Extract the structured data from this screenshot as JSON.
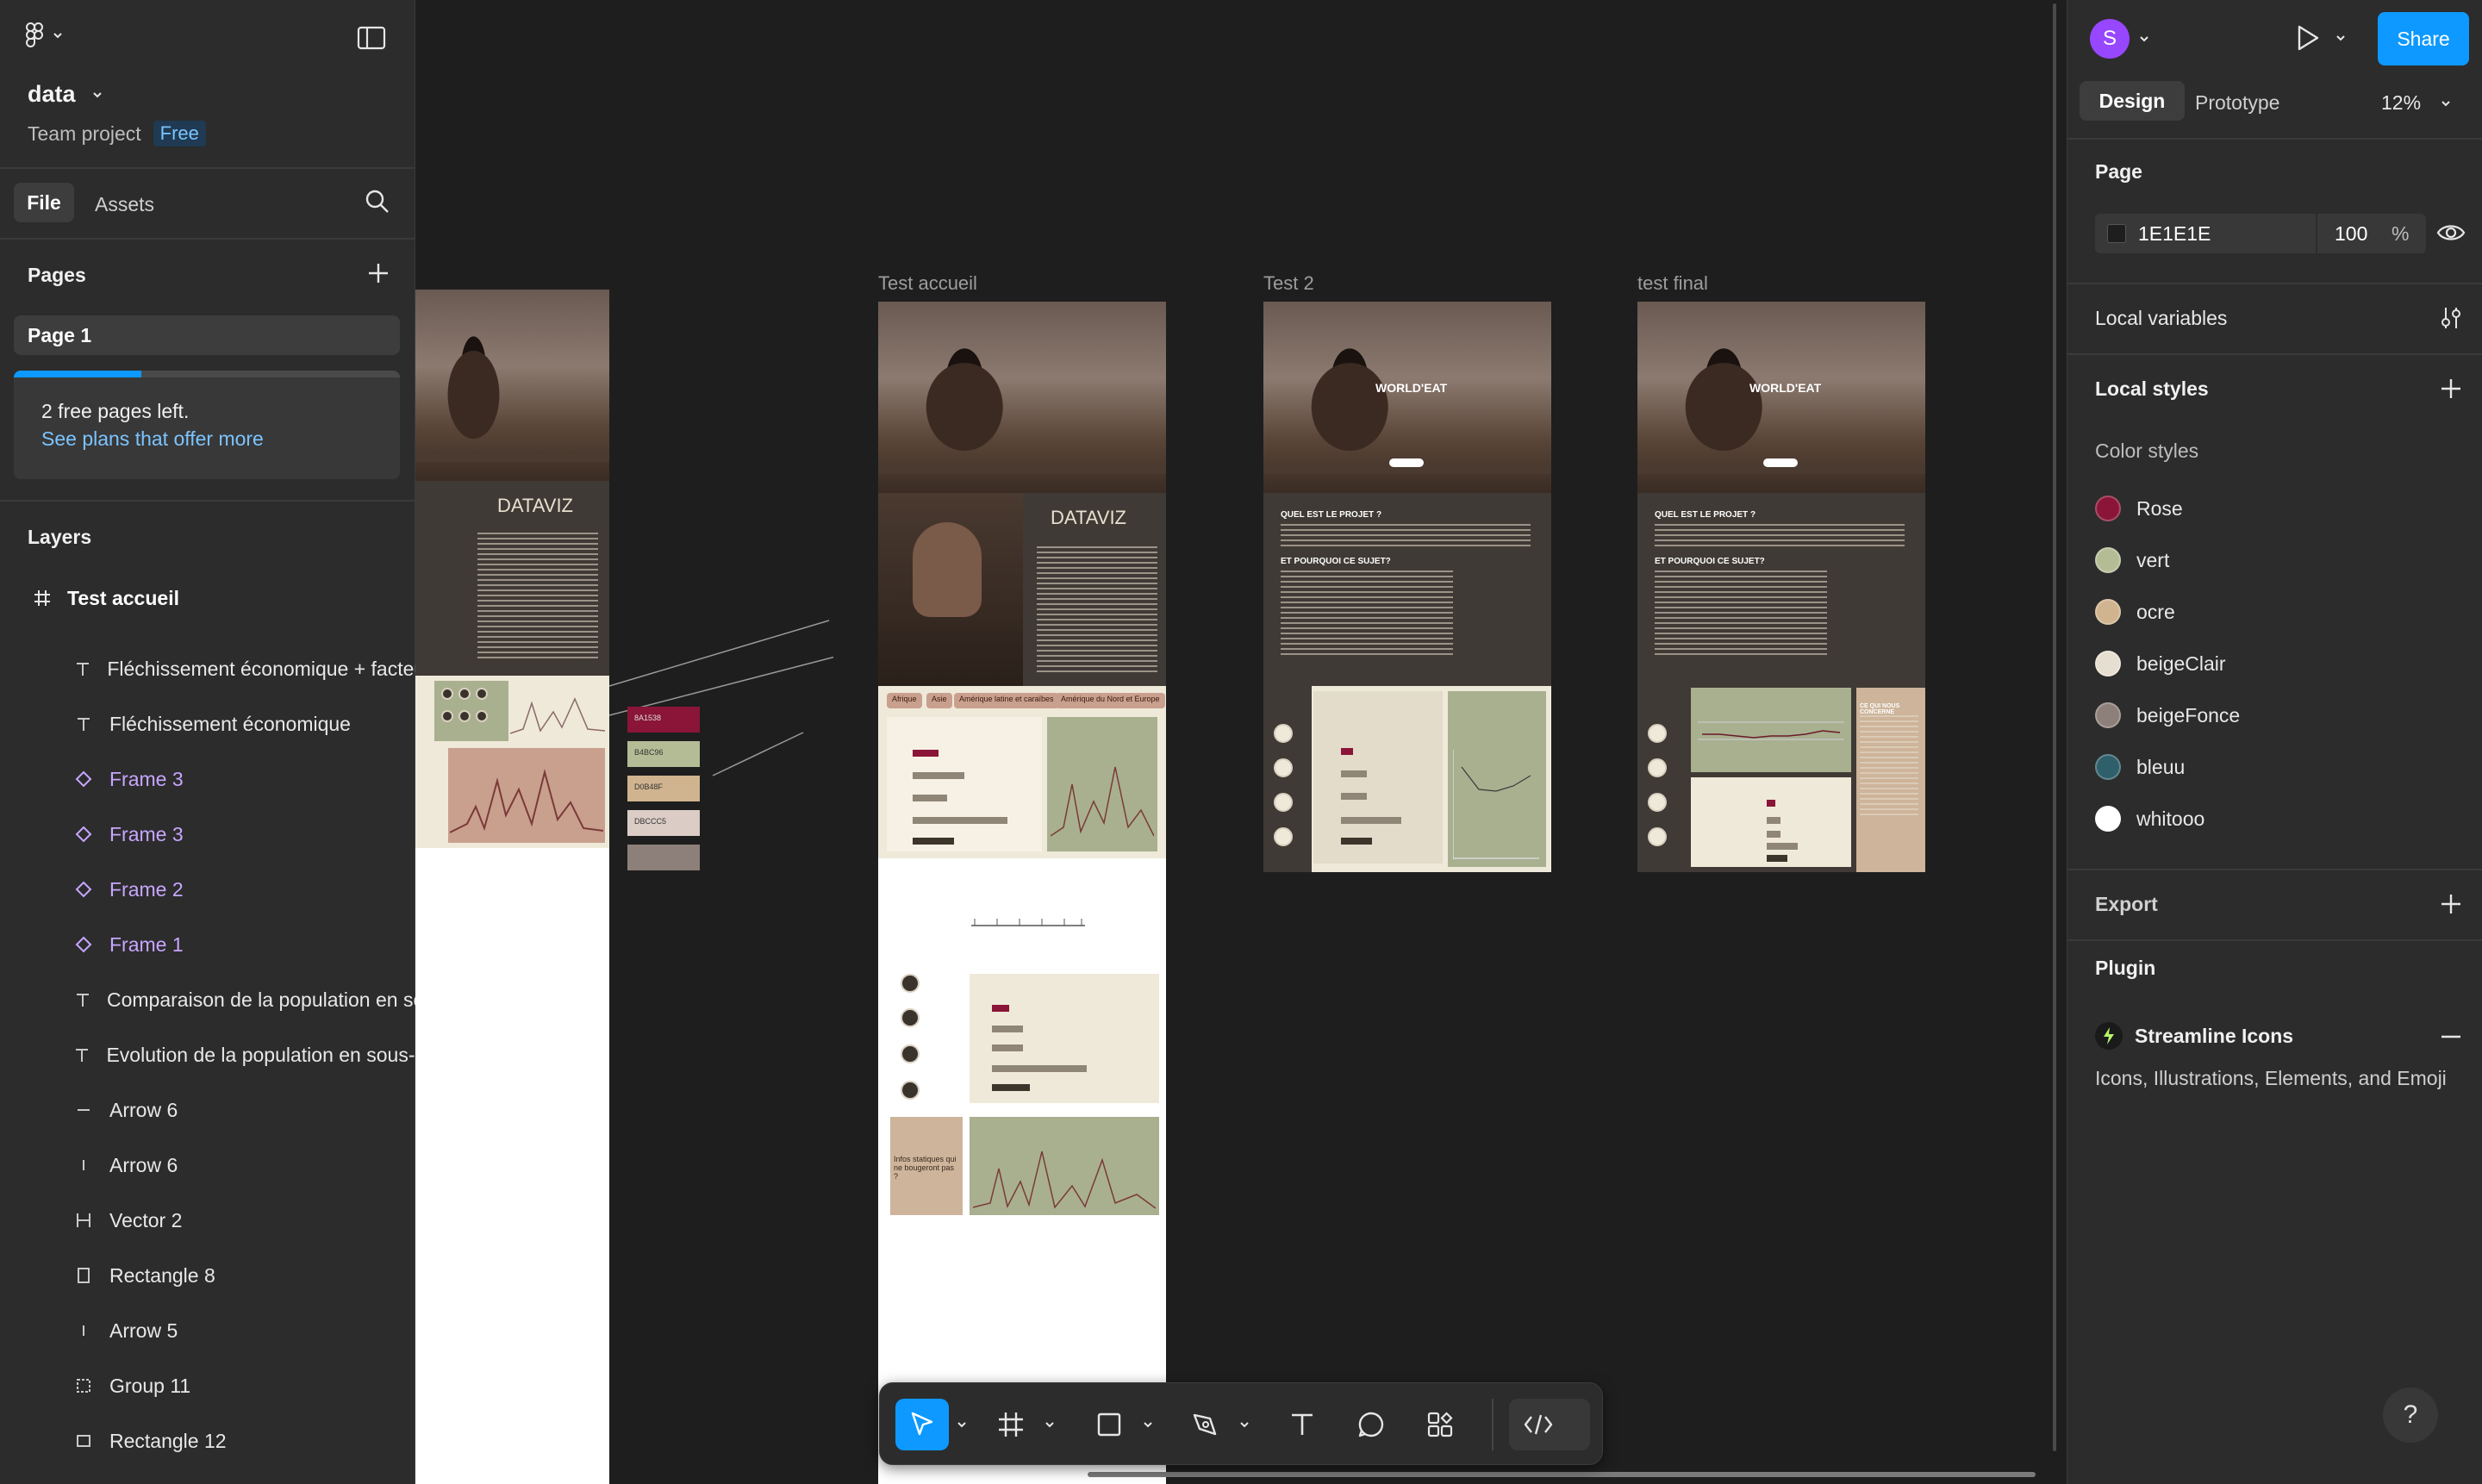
{
  "app": {
    "file_name": "data",
    "project": "Team project",
    "plan_badge": "Free"
  },
  "left_panel": {
    "tabs": {
      "file": "File",
      "assets": "Assets"
    },
    "pages_title": "Pages",
    "current_page": "Page 1",
    "upsell": {
      "line1": "2 free pages left.",
      "link": "See plans that offer more",
      "progress": 0.33
    },
    "layers_title": "Layers",
    "layer_root": "Test accueil",
    "layers": [
      {
        "name": "Fléchissement économique + facteurs",
        "icon": "text-icon"
      },
      {
        "name": "Fléchissement économique",
        "icon": "text-icon"
      },
      {
        "name": "Frame 3",
        "icon": "component-icon"
      },
      {
        "name": "Frame 3",
        "icon": "component-icon"
      },
      {
        "name": "Frame 2",
        "icon": "component-icon"
      },
      {
        "name": "Frame 1",
        "icon": "component-icon"
      },
      {
        "name": "Comparaison de la population en sous",
        "icon": "text-icon"
      },
      {
        "name": "Evolution de la population en sous-alim",
        "icon": "text-icon"
      },
      {
        "name": "Arrow 6",
        "icon": "line-horizontal-icon"
      },
      {
        "name": "Arrow 6",
        "icon": "line-vertical-icon"
      },
      {
        "name": "Vector 2",
        "icon": "vector-icon"
      },
      {
        "name": "Rectangle 8",
        "icon": "rectangle-icon"
      },
      {
        "name": "Arrow 5",
        "icon": "line-vertical-icon"
      },
      {
        "name": "Group 11",
        "icon": "group-icon"
      },
      {
        "name": "Rectangle 12",
        "icon": "rectangle-icon"
      }
    ]
  },
  "canvas": {
    "frames": {
      "accueil": "Test accueil",
      "test2": "Test 2",
      "final": "test final"
    },
    "dataviz_label": "DATAVIZ",
    "brand": "WORLD'EAT",
    "question1": "QUEL EST LE PROJET ?",
    "question2": "ET POURQUOI CE SUJET?",
    "chips": [
      "Afrique",
      "Asie",
      "Amérique latine et caraïbes",
      "Amérique du Nord et Europe"
    ],
    "palette_codes": [
      "8A1538",
      "B4BC96",
      "D0B48F",
      "DBCCC5",
      ""
    ],
    "aside_text": "Infos statiques qui ne bougeront pas ?",
    "final_side_title": "CE QUI NOUS CONCERNE"
  },
  "right_panel": {
    "avatar_initial": "S",
    "share_label": "Share",
    "tabs": {
      "design": "Design",
      "prototype": "Prototype"
    },
    "zoom": "12%",
    "page_section": "Page",
    "page_color": "1E1E1E",
    "page_opacity": "100",
    "percent_sign": "%",
    "local_variables": "Local variables",
    "local_styles": "Local styles",
    "color_styles_title": "Color styles",
    "color_styles": [
      {
        "name": "Rose",
        "color": "#8a1538"
      },
      {
        "name": "vert",
        "color": "#b4bc96"
      },
      {
        "name": "ocre",
        "color": "#d0b48f"
      },
      {
        "name": "beigeClair",
        "color": "#e6ded0"
      },
      {
        "name": "beigeFonce",
        "color": "#8d7f79"
      },
      {
        "name": "bleuu",
        "color": "#2f5f6a"
      },
      {
        "name": "whitooo",
        "color": "#ffffff"
      }
    ],
    "export": "Export",
    "plugin_title": "Plugin",
    "plugin_name": "Streamline Icons",
    "plugin_desc": "Icons, Illustrations, Elements, and Emoji"
  },
  "help_label": "?",
  "colors": {
    "accent": "#0d99ff",
    "canvas": "#1e1e1e",
    "panel": "#2c2c2c",
    "component": "#c7a6ff",
    "avatar": "#9747ff"
  }
}
